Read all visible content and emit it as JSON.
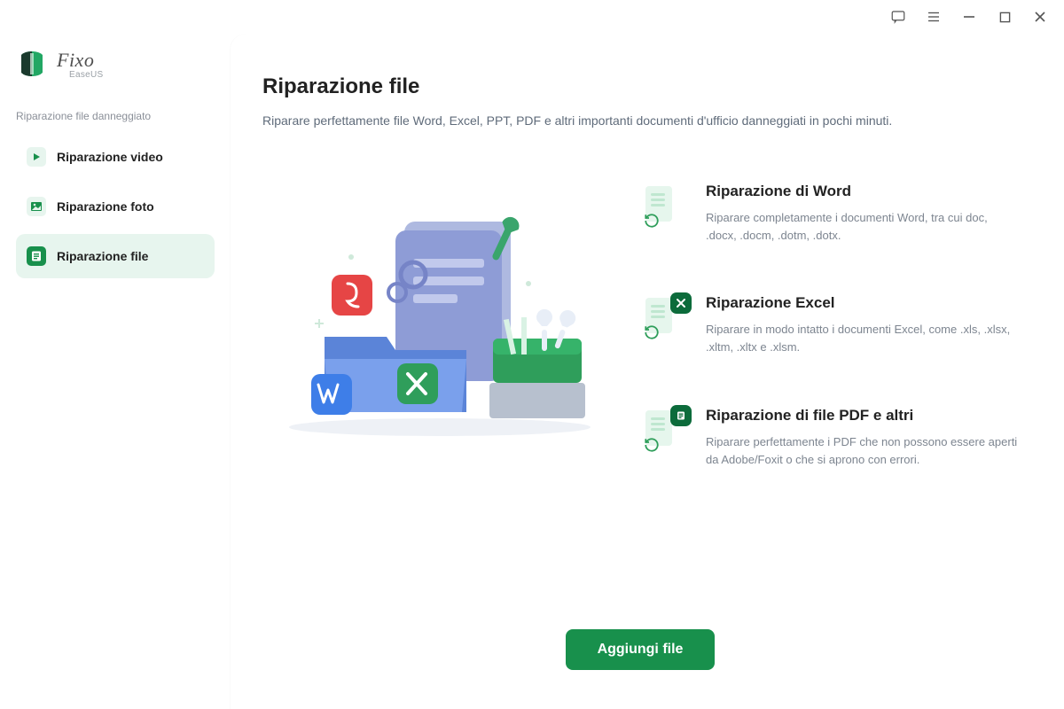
{
  "brand": {
    "name": "Fixo",
    "vendor": "EaseUS"
  },
  "sidebar": {
    "section_title": "Riparazione file danneggiato",
    "items": [
      {
        "label": "Riparazione video"
      },
      {
        "label": "Riparazione foto"
      },
      {
        "label": "Riparazione file"
      }
    ],
    "active_index": 2
  },
  "page": {
    "title": "Riparazione file",
    "subtitle": "Riparare perfettamente file Word, Excel, PPT, PDF e altri importanti documenti d'ufficio danneggiati in pochi minuti."
  },
  "features": [
    {
      "title": "Riparazione di Word",
      "desc": "Riparare completamente i documenti Word, tra cui doc, .docx, .docm, .dotm, .dotx.",
      "badge_color": "#0c6b3b"
    },
    {
      "title": "Riparazione Excel",
      "desc": "Riparare in modo intatto i documenti Excel, come .xls, .xlsx, .xltm, .xltx e .xlsm.",
      "badge_color": "#0c6b3b"
    },
    {
      "title": "Riparazione di file PDF e altri",
      "desc": "Riparare perfettamente i PDF che non possono essere aperti da Adobe/Foxit o che si aprono con errori.",
      "badge_color": "#0c6b3b"
    }
  ],
  "actions": {
    "primary": "Aggiungi file"
  }
}
